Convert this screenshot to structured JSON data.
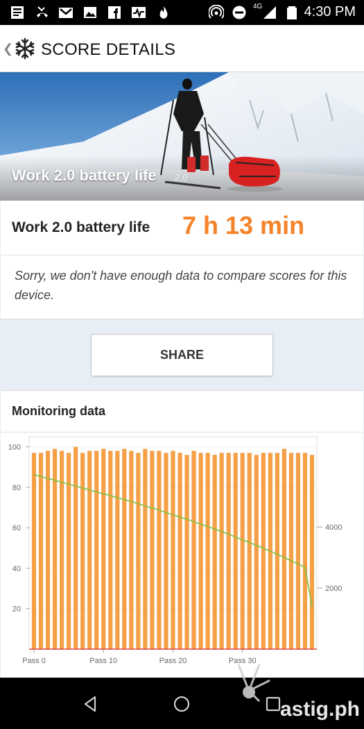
{
  "status_bar": {
    "time": "4:30 PM",
    "network": "4G",
    "icons": [
      "news-icon",
      "missed-call-icon",
      "gmail-icon",
      "photos-icon",
      "facebook-icon",
      "pulse-icon",
      "fire-icon",
      "hotspot-icon",
      "do-not-disturb-icon",
      "signal-icon",
      "battery-icon"
    ]
  },
  "app_bar": {
    "title": "SCORE DETAILS",
    "back_icon": "chevron-left-icon",
    "logo_icon": "snowflake-icon"
  },
  "hero": {
    "title": "Work 2.0 battery life",
    "version": "2.0"
  },
  "score": {
    "label": "Work 2.0 battery life",
    "value": "7 h 13 min"
  },
  "note": {
    "text": "Sorry, we don't have enough data to compare scores for this device."
  },
  "share": {
    "label": "SHARE"
  },
  "monitoring": {
    "title": "Monitoring data"
  },
  "chart_data": {
    "type": "bar",
    "left_axis": {
      "ylim": [
        0,
        105
      ],
      "ticks": [
        "100",
        "80",
        "60",
        "40",
        "20"
      ]
    },
    "right_axis": {
      "ticks": [
        "4000",
        "2000"
      ]
    },
    "x_ticks": [
      "Pass 0",
      "Pass 10",
      "Pass 20",
      "Pass 30"
    ],
    "series": [
      {
        "type": "bar",
        "axis": "left",
        "color": "#f5a047",
        "values": [
          97,
          97,
          98,
          99,
          98,
          97,
          100,
          97,
          98,
          98,
          99,
          98,
          98,
          99,
          98,
          97,
          99,
          98,
          98,
          97,
          98,
          97,
          96,
          98,
          97,
          97,
          96,
          97,
          97,
          97,
          97,
          97,
          96,
          97,
          97,
          97,
          99,
          97,
          97,
          97,
          96
        ]
      },
      {
        "type": "line",
        "axis": "left",
        "color": "#7cc242",
        "values": [
          86.2,
          85.3,
          84.4,
          83.5,
          82.5,
          81.5,
          80.6,
          79.6,
          78.7,
          77.7,
          76.8,
          75.9,
          74.8,
          73.9,
          72.9,
          71.9,
          70.8,
          69.8,
          68.7,
          67.5,
          66.4,
          65.3,
          64.2,
          63.0,
          61.8,
          60.6,
          59.4,
          58.1,
          56.8,
          55.4,
          54.0,
          52.7,
          51.3,
          49.9,
          48.4,
          46.9,
          45.3,
          43.7,
          42.1,
          40.5,
          21.0
        ]
      }
    ]
  }
}
